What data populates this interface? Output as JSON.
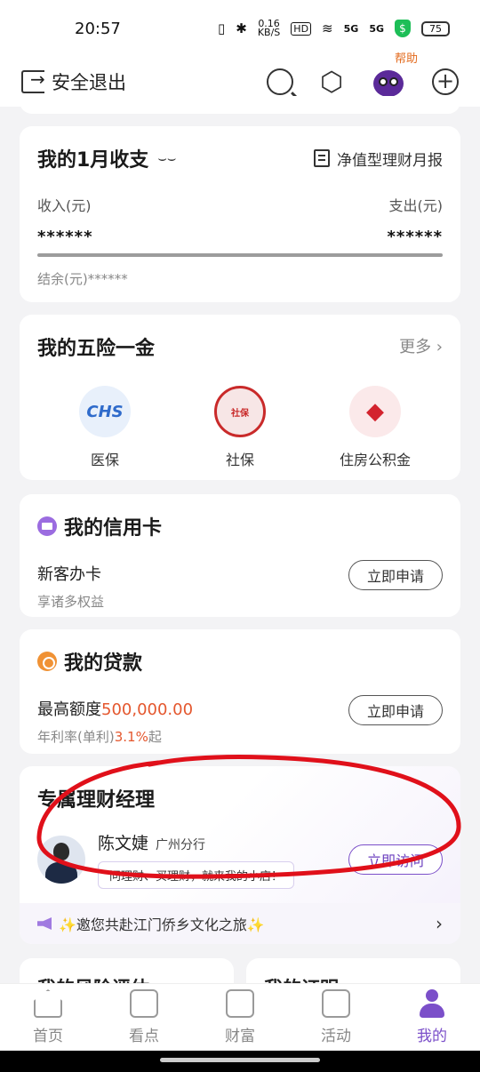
{
  "status_bar": {
    "time": "20:57",
    "net_speed": "0.16",
    "net_unit": "KB/S",
    "hd": "HD",
    "sig1": "5G",
    "sig2": "5G",
    "battery": "75"
  },
  "top_bar": {
    "logout_label": "安全退出",
    "help_label": "帮助"
  },
  "budget": {
    "title": "我的1月收支",
    "report_label": "净值型理财月报",
    "income_label": "收入(元)",
    "expense_label": "支出(元)",
    "income_value": "******",
    "expense_value": "******",
    "balance_label": "结余(元)",
    "balance_value": "******"
  },
  "insurance": {
    "title": "我的五险一金",
    "more_label": "更多",
    "items": [
      {
        "label": "医保",
        "logo_text": "CHS"
      },
      {
        "label": "社保",
        "logo_text": "社保"
      },
      {
        "label": "住房公积金",
        "logo_text": "◆"
      }
    ]
  },
  "credit_card": {
    "title": "我的信用卡",
    "subtitle": "新客办卡",
    "desc": "享诸多权益",
    "button": "立即申请"
  },
  "loan": {
    "title": "我的贷款",
    "limit_label": "最高额度",
    "limit_value": "500,000.00",
    "rate_label": "年利率(单利)",
    "rate_value": "3.1%",
    "rate_suffix": "起",
    "button": "立即申请"
  },
  "manager": {
    "title": "专属理财经理",
    "name": "陈文婕",
    "branch": "广州分行",
    "bubble": "问理财、买理财，就来我的小店！",
    "button": "立即访问",
    "notice": "✨邀您共赴江门侨乡文化之旅✨"
  },
  "bottom_cards": {
    "left": "我的风险评估",
    "right": "我的证明"
  },
  "tabs": [
    {
      "label": "首页",
      "icon": "home-icon",
      "active": false
    },
    {
      "label": "看点",
      "icon": "notes-icon",
      "active": false
    },
    {
      "label": "财富",
      "icon": "chart-icon",
      "active": false
    },
    {
      "label": "活动",
      "icon": "gift-icon",
      "active": false
    },
    {
      "label": "我的",
      "icon": "person-icon",
      "active": true
    }
  ],
  "colors": {
    "accent": "#7b4fc9",
    "highlight": "#e4572e",
    "scribble": "#e0101a"
  }
}
